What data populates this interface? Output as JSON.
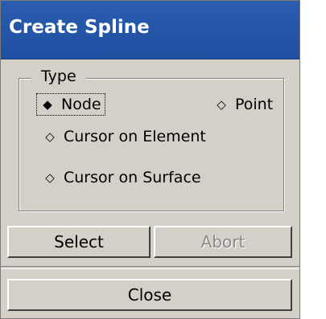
{
  "window": {
    "title": "Create Spline"
  },
  "type_group": {
    "legend": "Type",
    "options": [
      {
        "label": "Node",
        "selected": true
      },
      {
        "label": "Point",
        "selected": false
      },
      {
        "label": "Cursor on Element",
        "selected": false
      },
      {
        "label": "Cursor on Surface",
        "selected": false
      }
    ]
  },
  "buttons": {
    "select": "Select",
    "abort": "Abort",
    "close": "Close"
  },
  "glyphs": {
    "selected": "◆",
    "unselected": "◇"
  }
}
